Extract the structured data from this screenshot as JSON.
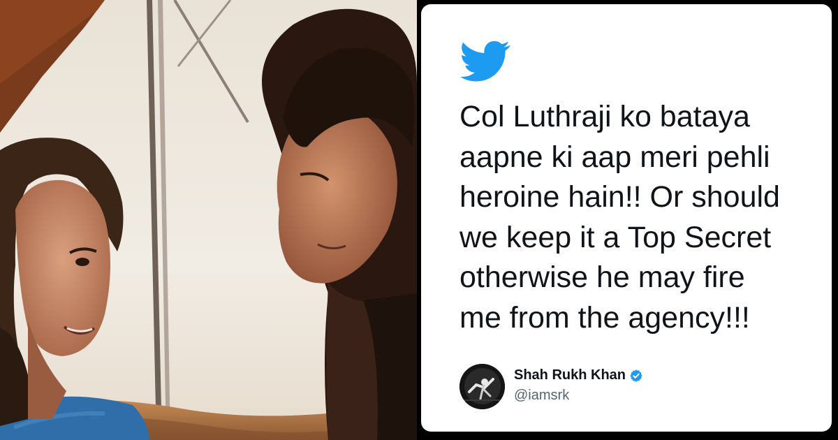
{
  "tweet": {
    "lines": [
      "Col Luthraji ko bataya",
      "aapne ki aap meri pehli",
      "heroine hain!! Or should",
      "we keep it a Top Secret",
      "otherwise he may fire",
      "me from the agency!!!"
    ]
  },
  "author": {
    "name": "Shah Rukh Khan",
    "handle": "@iamsrk",
    "verified": true
  },
  "icons": {
    "brand": "twitter-bird-icon",
    "badge": "verified-badge-icon"
  },
  "colors": {
    "twitter_blue": "#1d9bf0",
    "text": "#0f1419",
    "secondary_text": "#536471",
    "card_background": "#ffffff",
    "frame": "#000000"
  }
}
